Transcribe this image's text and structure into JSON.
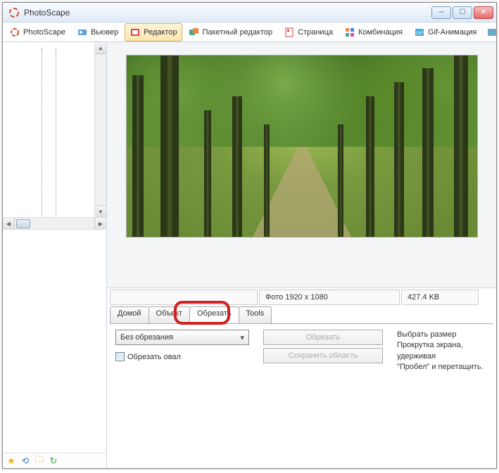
{
  "window": {
    "title": "PhotoScape"
  },
  "toolbar": {
    "items": [
      {
        "label": "PhotoScape"
      },
      {
        "label": "Вьювер"
      },
      {
        "label": "Редактор"
      },
      {
        "label": "Пакетный редактор"
      },
      {
        "label": "Страница"
      },
      {
        "label": "Комбинация"
      },
      {
        "label": "Gif-Анимация"
      }
    ]
  },
  "info": {
    "dimensions": "Фото 1920 x 1080",
    "filesize": "427.4 KB"
  },
  "editor_tabs": [
    {
      "label": "Домой"
    },
    {
      "label": "Объект"
    },
    {
      "label": "Обрезать"
    },
    {
      "label": "Tools"
    }
  ],
  "crop": {
    "mode": "Без обрезания",
    "oval_label": "Обрезать овал",
    "crop_btn": "Обрезать",
    "save_area_btn": "Сохранить область",
    "help_line1": "Выбрать размер",
    "help_line2": "Прокрутка экрана, удерживая",
    "help_line3": "\"Пробел\" и перетащить."
  }
}
